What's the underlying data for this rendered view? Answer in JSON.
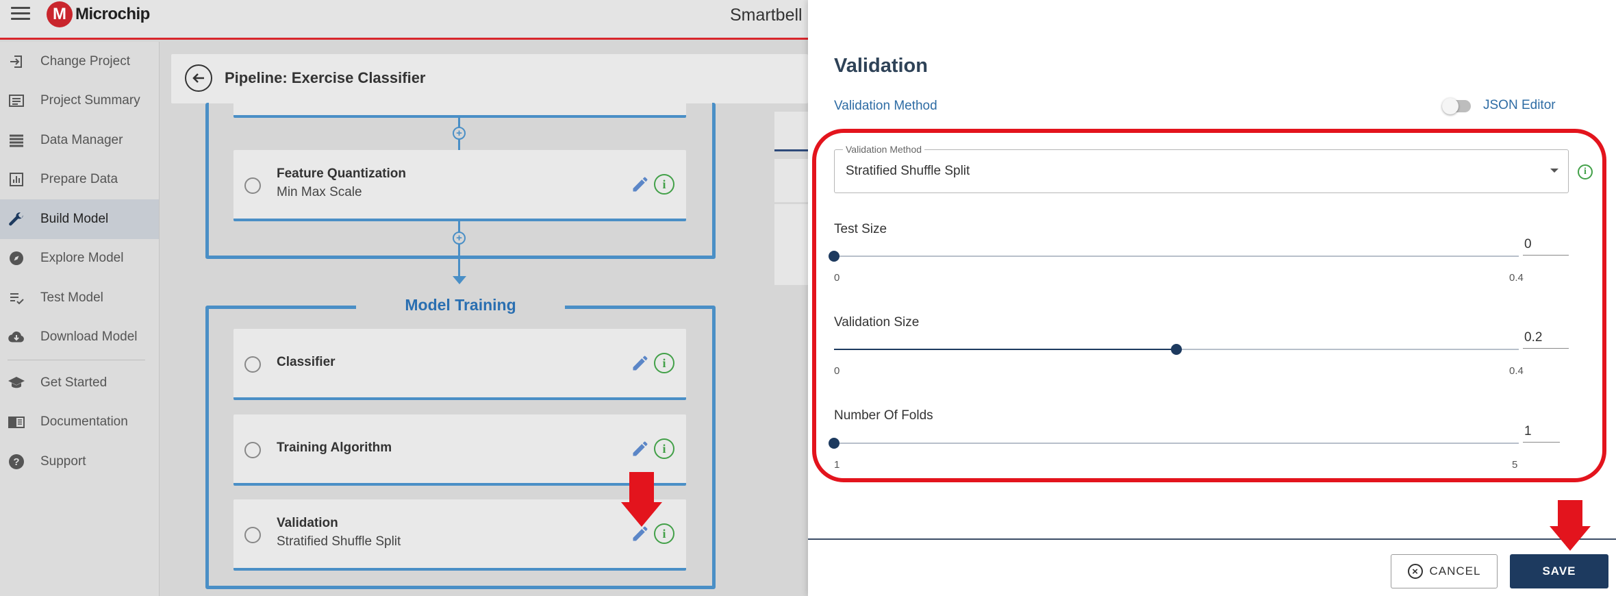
{
  "header": {
    "brand": "Microchip",
    "app_title": "Smartbell"
  },
  "sidebar": {
    "items": [
      {
        "label": "Change Project",
        "icon": "login-arrow-icon"
      },
      {
        "label": "Project Summary",
        "icon": "summary-list-icon"
      },
      {
        "label": "Data Manager",
        "icon": "storage-list-icon"
      },
      {
        "label": "Prepare Data",
        "icon": "bar-chart-icon"
      },
      {
        "label": "Build Model",
        "icon": "wrench-icon",
        "active": true
      },
      {
        "label": "Explore Model",
        "icon": "compass-icon"
      },
      {
        "label": "Test Model",
        "icon": "checklist-icon"
      },
      {
        "label": "Download Model",
        "icon": "cloud-download-icon"
      }
    ],
    "secondary_items": [
      {
        "label": "Get Started",
        "icon": "graduation-cap-icon"
      },
      {
        "label": "Documentation",
        "icon": "book-icon"
      },
      {
        "label": "Support",
        "icon": "help-circle-icon"
      }
    ]
  },
  "pipeline": {
    "title": "Pipeline: Exercise Classifier",
    "section_title": "Model Training",
    "steps": [
      {
        "title": "Feature Quantization",
        "subtitle": "Min Max Scale"
      },
      {
        "title": "Classifier",
        "subtitle": ""
      },
      {
        "title": "Training Algorithm",
        "subtitle": ""
      },
      {
        "title": "Validation",
        "subtitle": "Stratified Shuffle Split"
      }
    ]
  },
  "dialog": {
    "title": "Validation",
    "subtitle": "Validation Method",
    "json_editor_label": "JSON Editor",
    "json_editor_on": false,
    "select": {
      "label": "Validation Method",
      "value": "Stratified Shuffle Split"
    },
    "sliders": [
      {
        "label": "Test Size",
        "value": "0",
        "min": "0",
        "max": "0.4",
        "fraction": 0.0
      },
      {
        "label": "Validation Size",
        "value": "0.2",
        "min": "0",
        "max": "0.4",
        "fraction": 0.5
      },
      {
        "label": "Number Of Folds",
        "value": "1",
        "min": "1",
        "max": "5",
        "fraction": 0.0
      }
    ],
    "cancel_label": "CANCEL",
    "save_label": "SAVE"
  },
  "colors": {
    "accent_red": "#e3141d",
    "pipeline_blue": "#4a8fc6",
    "navy": "#1d3a5f",
    "info_green": "#42a048"
  }
}
